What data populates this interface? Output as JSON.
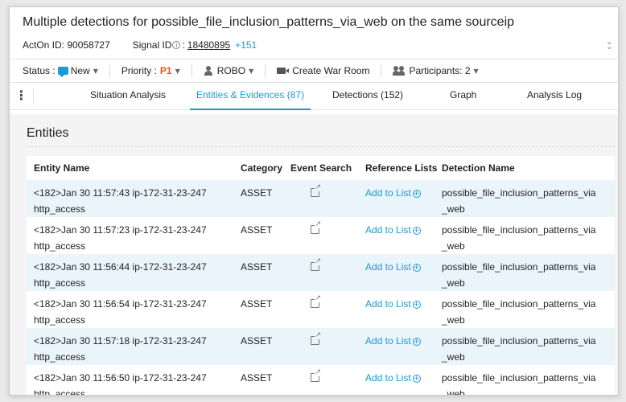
{
  "header": {
    "title": "Multiple detections for possible_file_inclusion_patterns_via_web on the same sourceip",
    "acton_label": "ActOn ID: 90058727",
    "signal_label": "Signal ID",
    "signal_sep": ":",
    "signal_id": "18480895",
    "signal_extra": "+151"
  },
  "statusbar": {
    "status_label": "Status :",
    "status_value": "New",
    "priority_label": "Priority :",
    "priority_value": "P1",
    "assignee": "ROBO",
    "war_room": "Create War Room",
    "participants": "Participants: 2"
  },
  "tabs": [
    {
      "label": "Situation Analysis"
    },
    {
      "label": "Entities & Evidences (87)"
    },
    {
      "label": "Detections (152)"
    },
    {
      "label": "Graph"
    },
    {
      "label": "Analysis Log"
    }
  ],
  "entities": {
    "title": "Entities",
    "columns": [
      "Entity Name",
      "Category",
      "Event Search",
      "Reference Lists",
      "Detection Name"
    ],
    "add_label": "Add to List",
    "rows": [
      {
        "name_line1": "<182>Jan 30 11:57:43 ip-172-31-23-247",
        "name_line2": "http_access",
        "category": "ASSET",
        "detection": "possible_file_inclusion_patterns_via_web"
      },
      {
        "name_line1": "<182>Jan 30 11:57:23 ip-172-31-23-247",
        "name_line2": "http_access",
        "category": "ASSET",
        "detection": "possible_file_inclusion_patterns_via_web"
      },
      {
        "name_line1": "<182>Jan 30 11:56:44 ip-172-31-23-247",
        "name_line2": "http_access",
        "category": "ASSET",
        "detection": "possible_file_inclusion_patterns_via_web"
      },
      {
        "name_line1": "<182>Jan 30 11:56:54 ip-172-31-23-247",
        "name_line2": "http_access",
        "category": "ASSET",
        "detection": "possible_file_inclusion_patterns_via_web"
      },
      {
        "name_line1": "<182>Jan 30 11:57:18 ip-172-31-23-247",
        "name_line2": "http_access",
        "category": "ASSET",
        "detection": "possible_file_inclusion_patterns_via_web"
      },
      {
        "name_line1": "<182>Jan 30 11:56:50 ip-172-31-23-247",
        "name_line2": "http_access",
        "category": "ASSET",
        "detection": "possible_file_inclusion_patterns_via_web"
      }
    ]
  },
  "colors": {
    "accent": "#1a9ad6",
    "priority": "#e8590c",
    "row_highlight": "#eaf4fb"
  }
}
